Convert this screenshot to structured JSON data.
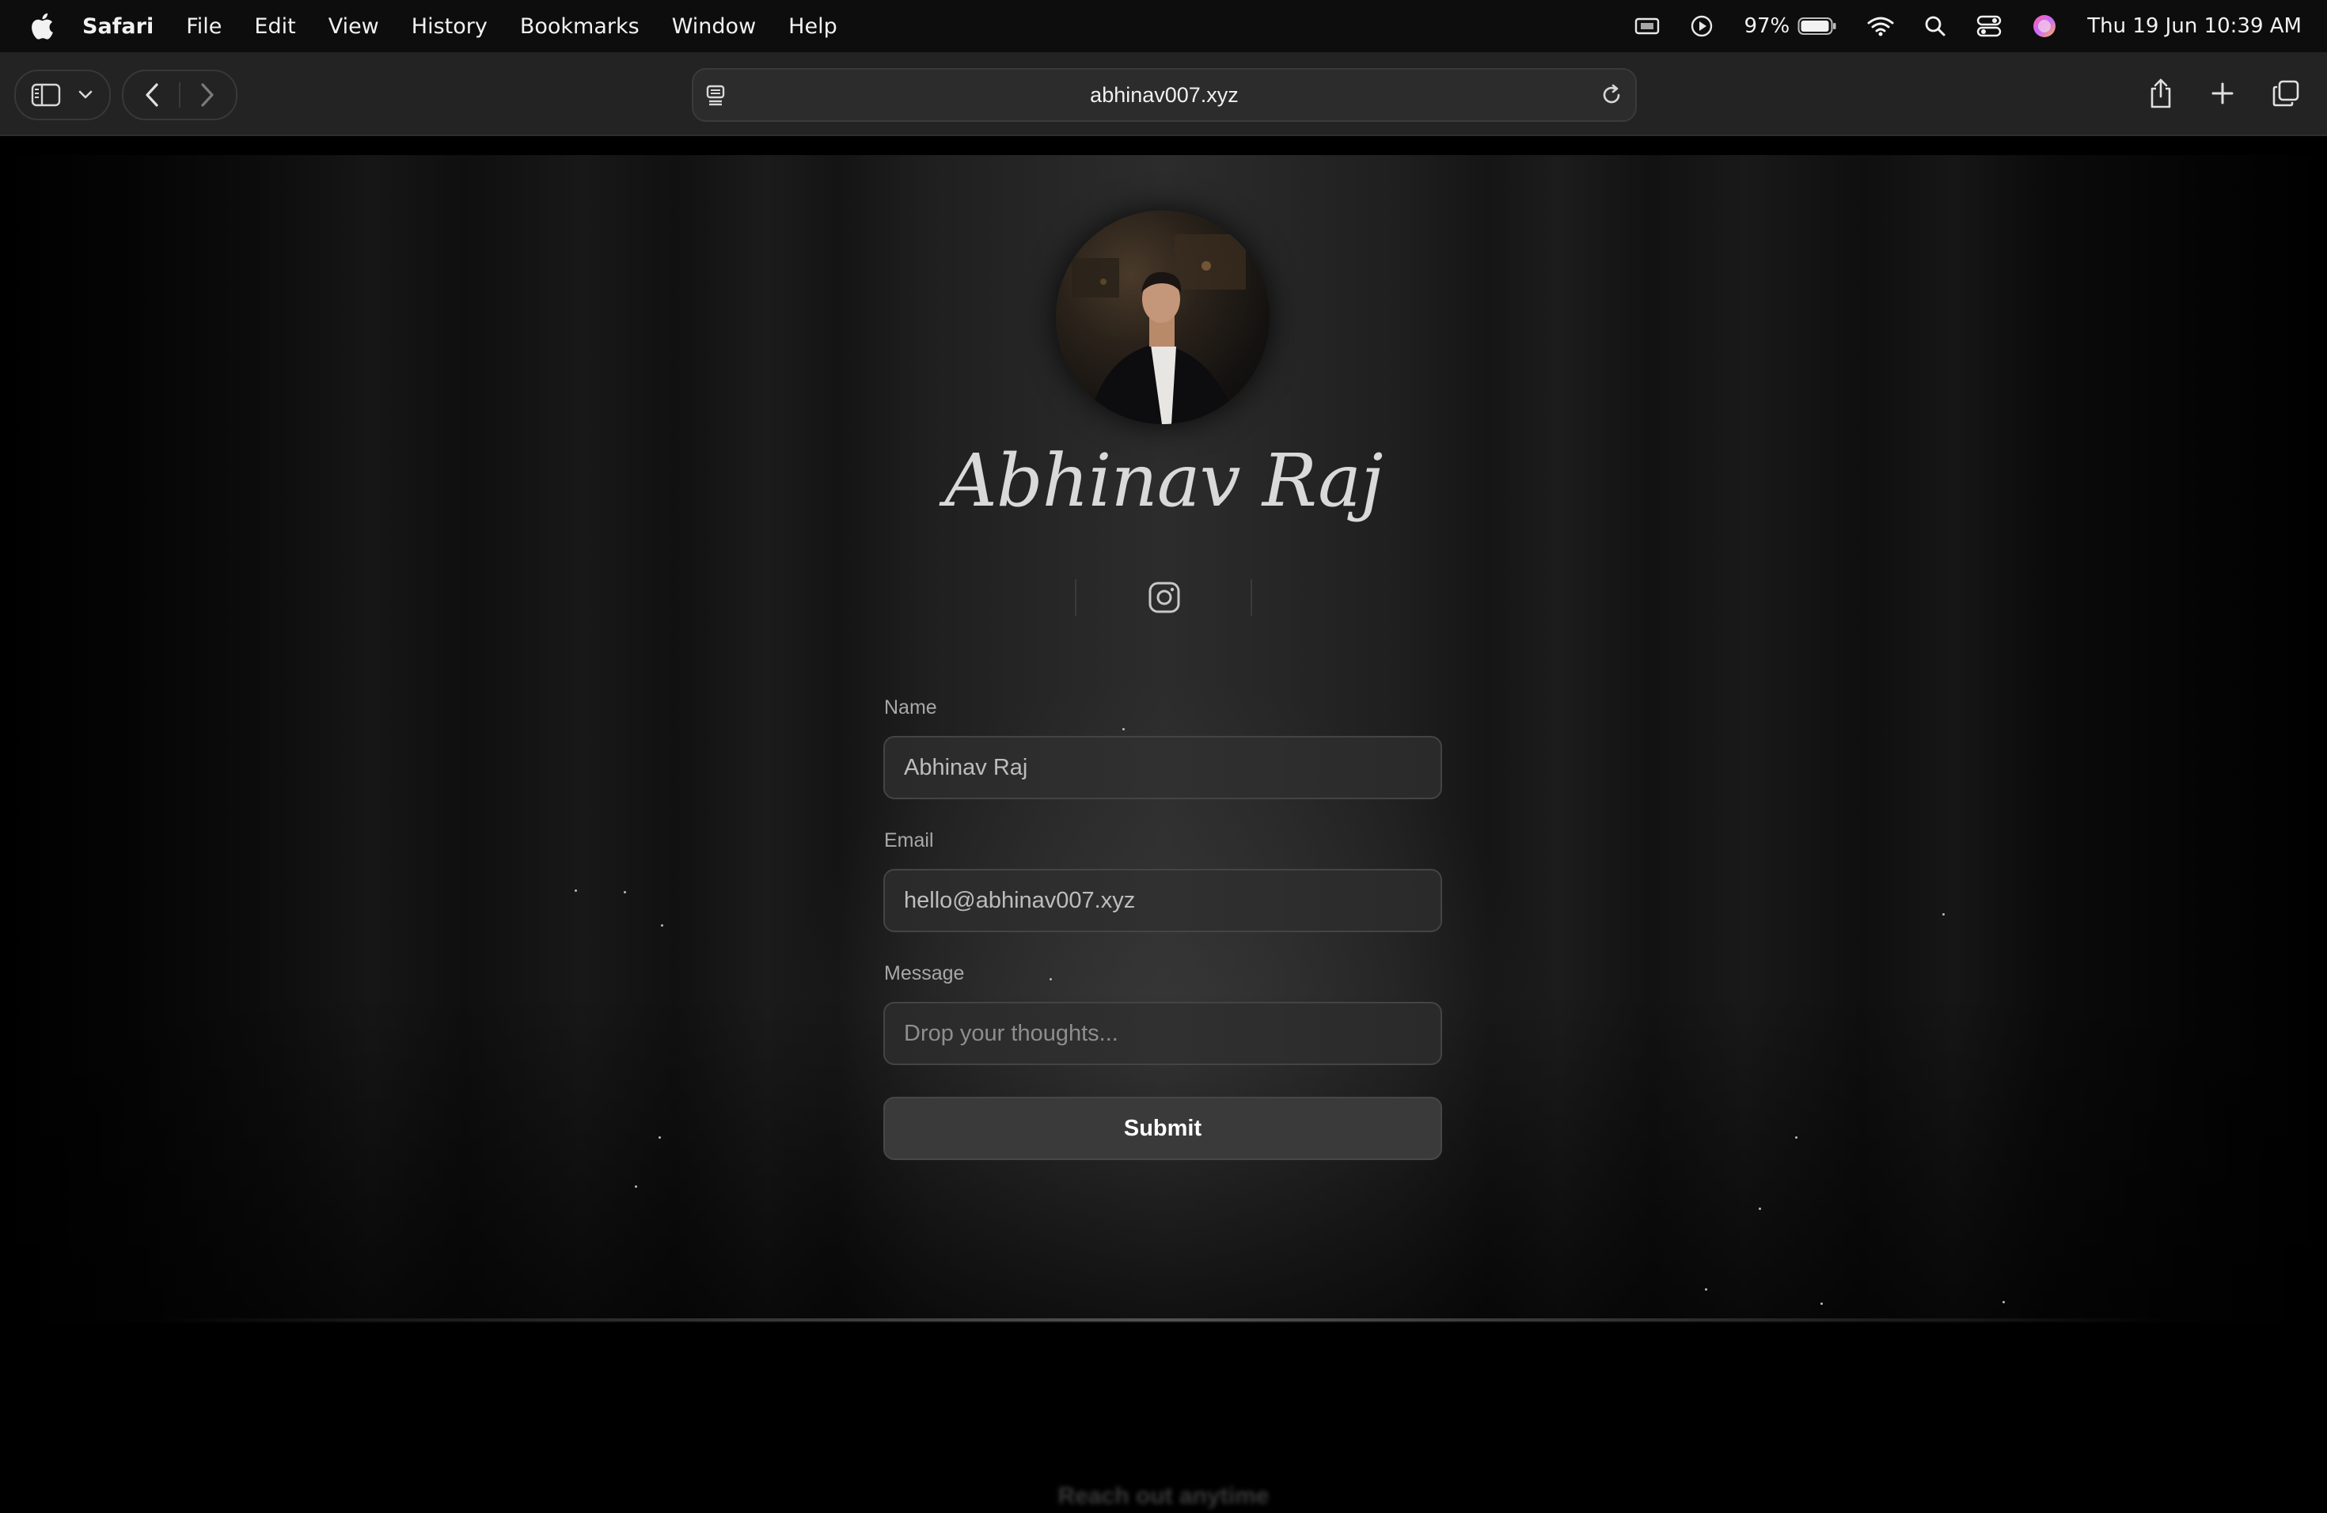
{
  "menubar": {
    "app_name": "Safari",
    "items": [
      "File",
      "Edit",
      "View",
      "History",
      "Bookmarks",
      "Window",
      "Help"
    ],
    "battery_percent": "97%",
    "datetime": "Thu 19 Jun  10:39 AM",
    "icons": [
      "apple-icon",
      "display-icon",
      "play-icon",
      "battery-icon",
      "wifi-icon",
      "search-icon",
      "control-center-icon",
      "siri-icon"
    ]
  },
  "browser": {
    "url": "abhinav007.xyz",
    "icons": [
      "sidebar-icon",
      "chevron-down-icon",
      "back-icon",
      "forward-icon",
      "page-menu-icon",
      "reload-icon",
      "share-icon",
      "new-tab-icon",
      "tabs-overview-icon"
    ]
  },
  "profile": {
    "name": "Abhinav Raj",
    "social_icon": "instagram-icon"
  },
  "form": {
    "name_label": "Name",
    "name_value": "Abhinav Raj",
    "email_label": "Email",
    "email_value": "hello@abhinav007.xyz",
    "message_label": "Message",
    "message_placeholder": "Drop your thoughts...",
    "submit_label": "Submit"
  },
  "footer": {
    "text": "Reach out anytime"
  },
  "colors": {
    "background": "#000000",
    "field_bg": "#2c2c2c",
    "button_bg": "#3a3a3a",
    "title_text": "#d9d9d9"
  }
}
